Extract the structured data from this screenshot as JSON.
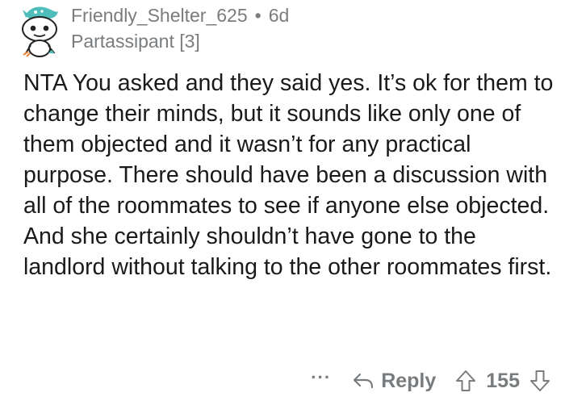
{
  "comment": {
    "author": {
      "username": "Friendly_Shelter_625",
      "flair": "Partassipant [3]",
      "avatar": "snoo-avatar-icon"
    },
    "separator": "•",
    "age": "6d",
    "body": [
      "NTA You asked and they said yes. It’s ok for them to change their minds, but it sounds like only one of them objected and it wasn’t for any practical purpose. There should have been a discussion with all of the roommates to see if anyone else objected. And she certainly shouldn’t have gone to the landlord without talking to the other roommates first."
    ],
    "actions": {
      "more_label": "···",
      "reply_label": "Reply",
      "score": "155"
    }
  },
  "colors": {
    "text": "#1a1a1b",
    "meta": "#787c7e",
    "avatar_accent": "#4fbdba"
  }
}
